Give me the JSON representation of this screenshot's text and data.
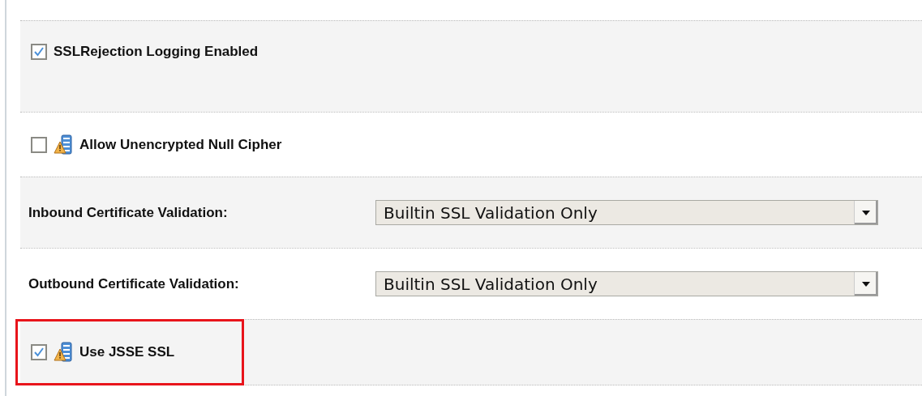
{
  "settings": [
    {
      "kind": "checkbox",
      "label": "SSLRejection Logging Enabled",
      "checked": true,
      "warning_icon": false,
      "highlighted": false
    },
    {
      "kind": "checkbox",
      "label": "Allow Unencrypted Null Cipher",
      "checked": false,
      "warning_icon": true,
      "highlighted": false
    },
    {
      "kind": "select",
      "label": "Inbound Certificate Validation:",
      "value": "Builtin SSL Validation Only"
    },
    {
      "kind": "select",
      "label": "Outbound Certificate Validation:",
      "value": "Builtin SSL Validation Only"
    },
    {
      "kind": "checkbox",
      "label": "Use JSSE SSL",
      "checked": true,
      "warning_icon": true,
      "highlighted": true
    }
  ]
}
